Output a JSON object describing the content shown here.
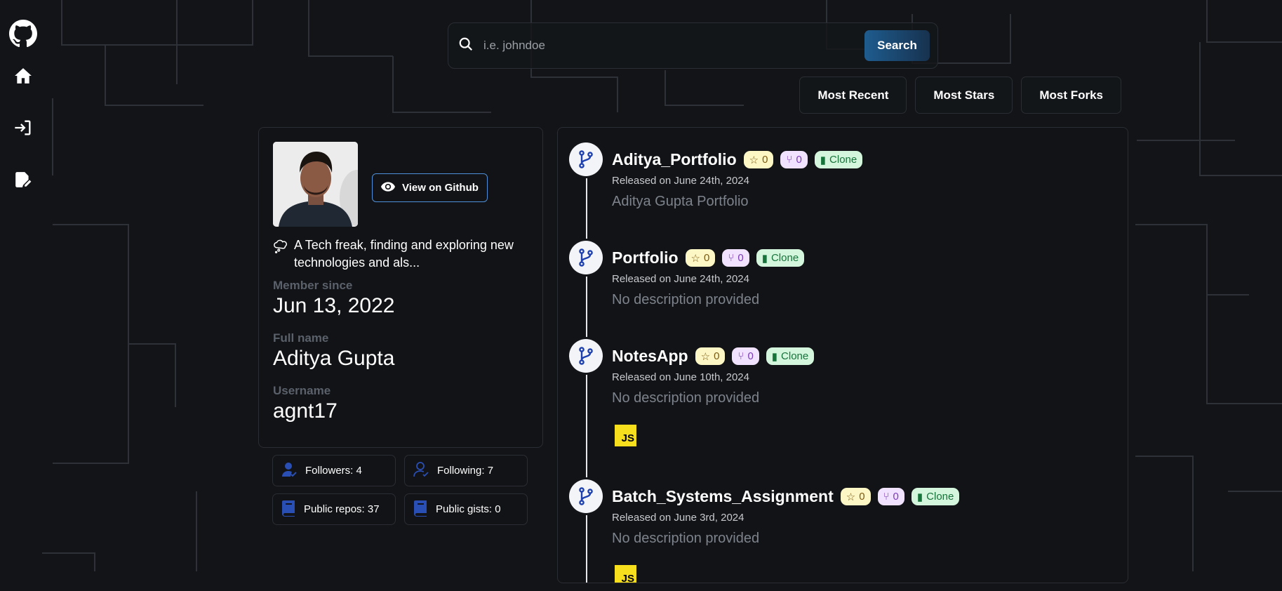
{
  "sidebar": {
    "items": [
      {
        "icon": "github-icon"
      },
      {
        "icon": "home-icon"
      },
      {
        "icon": "login-icon"
      },
      {
        "icon": "signup-icon"
      }
    ]
  },
  "search": {
    "placeholder": "i.e. johndoe",
    "button_label": "Search"
  },
  "sort": {
    "options": [
      "Most Recent",
      "Most Stars",
      "Most Forks"
    ]
  },
  "profile": {
    "view_button": "View on Github",
    "bio": "A Tech freak, finding and exploring new technologies and als...",
    "member_since_label": "Member since",
    "member_since": "Jun 13, 2022",
    "full_name_label": "Full name",
    "full_name": "Aditya Gupta",
    "username_label": "Username",
    "username": "agnt17"
  },
  "stats": {
    "followers": "Followers: 4",
    "following": "Following: 7",
    "public_repos": "Public repos: 37",
    "public_gists": "Public gists: 0"
  },
  "repos": [
    {
      "name": "Aditya_Portfolio",
      "stars": "0",
      "forks": "0",
      "clone": "Clone",
      "released": "Released on June 24th, 2024",
      "description": "Aditya Gupta Portfolio",
      "language": ""
    },
    {
      "name": "Portfolio",
      "stars": "0",
      "forks": "0",
      "clone": "Clone",
      "released": "Released on June 24th, 2024",
      "description": "No description provided",
      "language": ""
    },
    {
      "name": "NotesApp",
      "stars": "0",
      "forks": "0",
      "clone": "Clone",
      "released": "Released on June 10th, 2024",
      "description": "No description provided",
      "language": "JS"
    },
    {
      "name": "Batch_Systems_Assignment",
      "stars": "0",
      "forks": "0",
      "clone": "Clone",
      "released": "Released on June 3rd, 2024",
      "description": "No description provided",
      "language": "JS"
    }
  ]
}
